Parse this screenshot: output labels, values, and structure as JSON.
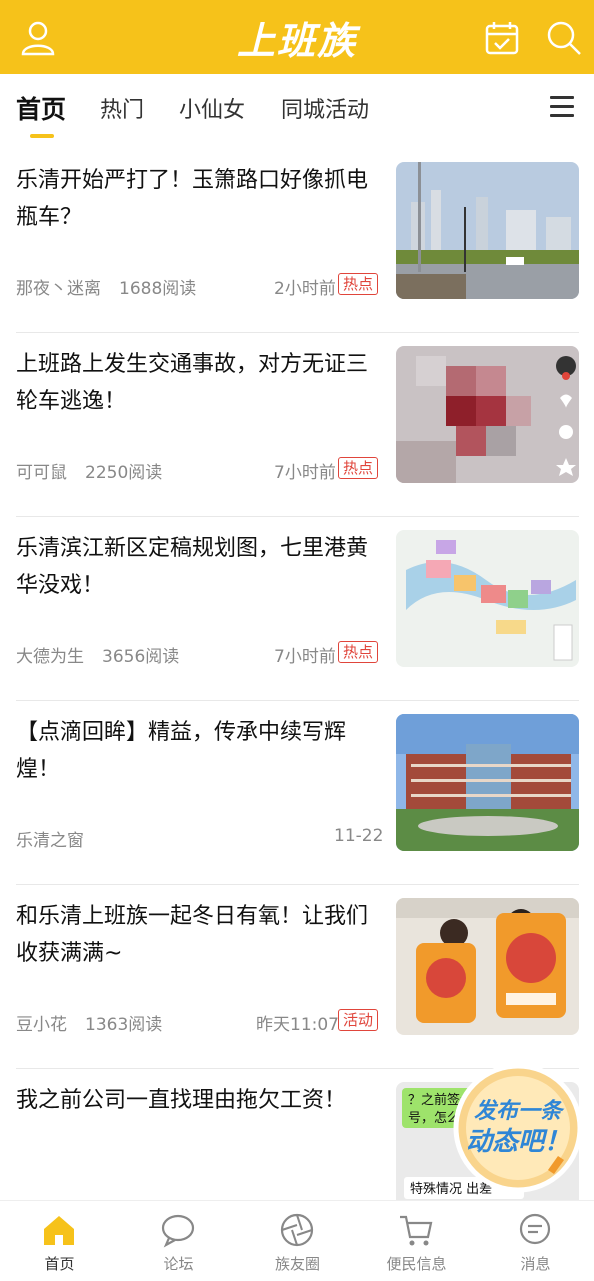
{
  "header": {
    "logo": "上班族",
    "user_icon": "user-icon",
    "calendar_icon": "calendar-icon",
    "search_icon": "search-icon",
    "brand_color": "#f6c21a"
  },
  "tabs": [
    {
      "label": "首页"
    },
    {
      "label": "热门"
    },
    {
      "label": "小仙女"
    },
    {
      "label": "同城活动"
    }
  ],
  "feed": [
    {
      "title": "乐清开始严打了！玉箫路口好像抓电瓶车？",
      "author": "那夜丶迷离",
      "reads": "1688阅读",
      "time": "2小时前",
      "tag": "热点"
    },
    {
      "title": "上班路上发生交通事故，对方无证三轮车逃逸！",
      "author": "可可鼠",
      "reads": "2250阅读",
      "time": "7小时前",
      "tag": "热点"
    },
    {
      "title": "乐清滨江新区定稿规划图，七里港黄华没戏！",
      "author": "大德为生",
      "reads": "3656阅读",
      "time": "7小时前",
      "tag": "热点"
    },
    {
      "title": "【点滴回眸】精益，传承中续写辉煌！",
      "author": "乐清之窗",
      "reads": "",
      "time": "11-22",
      "tag": ""
    },
    {
      "title": "和乐清上班族一起冬日有氧！让我们收获满满~",
      "author": "豆小花",
      "reads": "1363阅读",
      "time": "昨天11:07",
      "tag": "活动"
    },
    {
      "title": "我之前公司一直找理由拖欠工资！",
      "author": "",
      "reads": "",
      "time": "",
      "tag": ""
    }
  ],
  "thumb_text": {
    "chat_line1": "？之前签合",
    "chat_line2": "号，怎么",
    "chat_line3": "特殊情况 出差"
  },
  "fab": {
    "line1": "发布一条",
    "line2": "动态吧！"
  },
  "bottom_nav": [
    {
      "label": "首页"
    },
    {
      "label": "论坛"
    },
    {
      "label": "族友圈"
    },
    {
      "label": "便民信息"
    },
    {
      "label": "消息"
    }
  ]
}
